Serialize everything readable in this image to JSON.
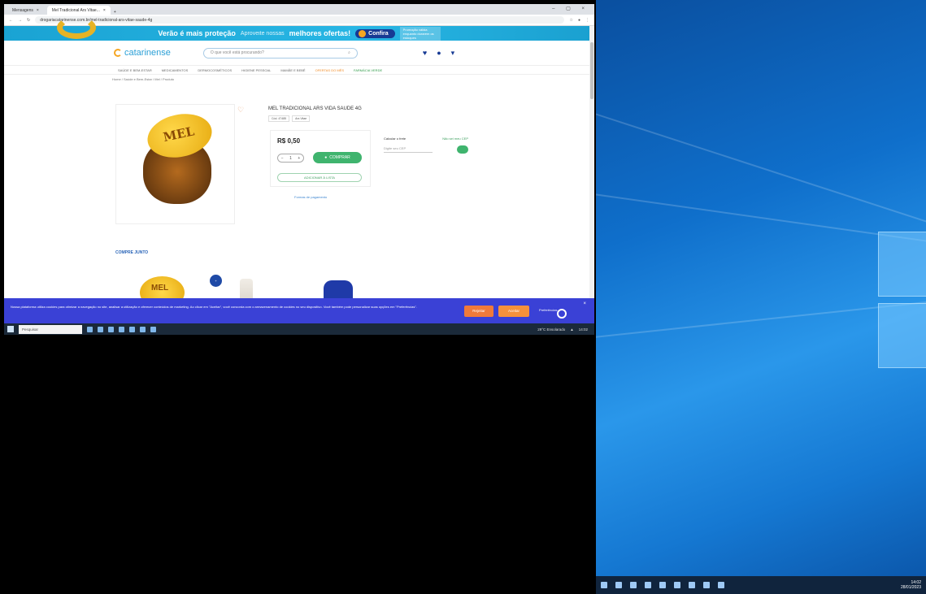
{
  "browser": {
    "tabs": [
      "Mensagens",
      "Mel Tradicional Ars Vitae..."
    ],
    "url": "drogariacatarinense.com.br/mel-tradicional-ars-vitae-saude-4g"
  },
  "banner": {
    "headline": "Verão é mais proteção",
    "subtext": "Aproveite nossas",
    "offers": "melhores ofertas!",
    "cta": "Confira",
    "fineprint": "Promoção válida enquanto durarem os estoques"
  },
  "header": {
    "logo": "catarinense",
    "search_placeholder": "O que você está procurando?"
  },
  "nav": [
    "SAÚDE E BEM-ESTAR",
    "MEDICAMENTOS",
    "DERMOCOSMÉTICOS",
    "HIGIENE PESSOAL",
    "MAMÃE E BEBÊ",
    "OFERTAS DO MÊS",
    "FARMÁCIA VERDE"
  ],
  "breadcrumb": "Home / Saúde e Bem-Estar / Mel / Produto",
  "product": {
    "title": "MEL TRADICIONAL ARS VIDA SAUDE 4G",
    "tags": [
      "Cód. 47485",
      "Ars Vitae"
    ],
    "lid_text": "MEL",
    "price": "R$ 0,50",
    "qty": "1",
    "buy_label": "COMPRAR",
    "list_label": "ADICIONAR À LISTA",
    "installments": "Formas de pagamento",
    "ship_label": "Calcular o frete",
    "ship_link": "Não sei meu CEP",
    "ship_placeholder": "Digite seu CEP"
  },
  "compre_junto": {
    "title": "COMPRE JUNTO",
    "badge": "+",
    "jar_text": "MEL"
  },
  "cookie": {
    "text": "Nossa plataforma utiliza cookies para otimizar a navegação no site, analisar a utilização e oferecer conteúdos de marketing. Ao clicar em \"Aceitar\", você concorda com o armazenamento de cookies no seu dispositivo. Você também pode personalizar suas opções em \"Preferências\".",
    "reject": "Rejeitar",
    "accept": "Aceitar",
    "prefs": "Preferências",
    "close": "×"
  },
  "taskbar": {
    "search": "Pesquisar",
    "weather": "29°C Ensolarado",
    "time": "14:02",
    "date": "28/01/2023"
  }
}
